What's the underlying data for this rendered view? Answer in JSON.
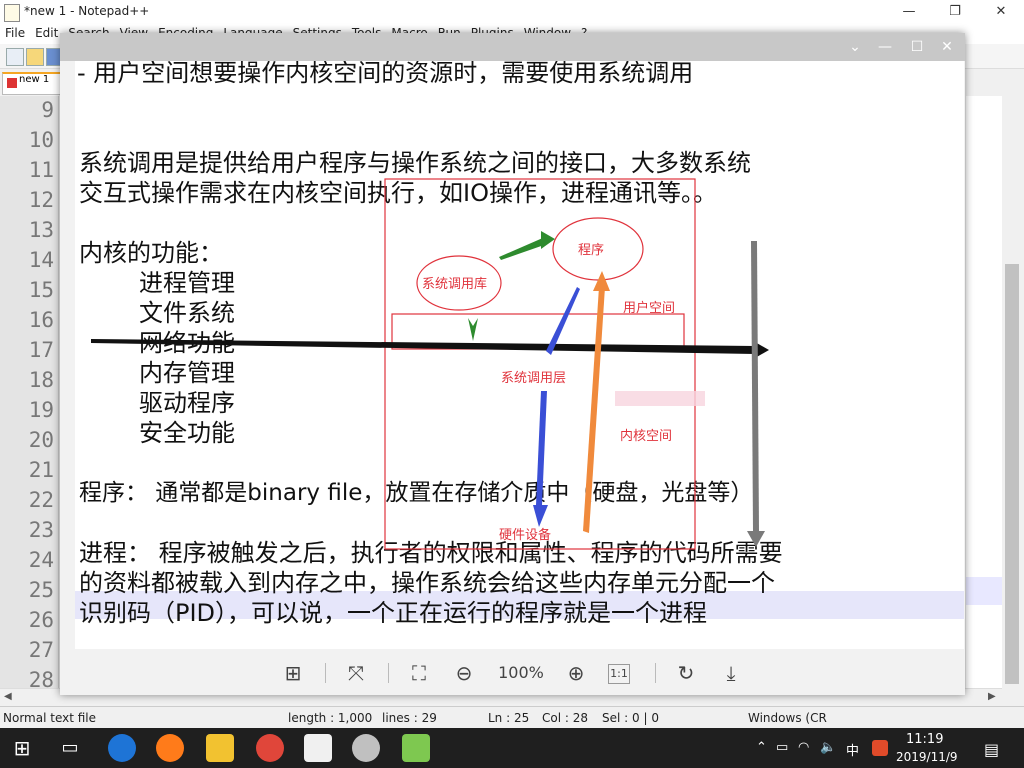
{
  "window": {
    "title": "*new 1 - Notepad++",
    "minimize": "—",
    "maximize": "❐",
    "close": "✕"
  },
  "menu": [
    "File",
    "Edit",
    "Search",
    "View",
    "Encoding",
    "Language",
    "Settings",
    "Tools",
    "Macro",
    "Run",
    "Plugins",
    "Window",
    "?"
  ],
  "tab": {
    "label": "new 1"
  },
  "line_numbers": [
    "9",
    "10",
    "11",
    "12",
    "13",
    "14",
    "15",
    "16",
    "17",
    "18",
    "19",
    "20",
    "21",
    "22",
    "23",
    "24",
    "25",
    "26",
    "27",
    "28"
  ],
  "status": {
    "filetype": "Normal text file",
    "length": "length : 1,000",
    "lines": "lines : 29",
    "ln": "Ln : 25",
    "col": "Col : 28",
    "sel": "Sel : 0 | 0",
    "eol": "Windows (CR"
  },
  "viewer": {
    "zoom": "100%",
    "controls": {
      "collapse": "⌄",
      "minimize": "—",
      "maximize": "☐",
      "close": "✕"
    }
  },
  "document": {
    "line_partial": "- 用户空间想要操作内核空间的资源时，需要使用系统调用",
    "para1": [
      "系统调用是提供给用户程序与操作系统之间的接口，大多数系统",
      "交互式操作需求在内核空间执行，如IO操作，进程通讯等。。"
    ],
    "kernel_heading": "内核的功能：",
    "kernel_items": [
      "进程管理",
      "文件系统",
      "网络功能",
      "内存管理",
      "驱动程序",
      "安全功能"
    ],
    "program_line": "程序：  通常都是binary file，放置在存储介质中（硬盘，光盘等）",
    "process_lines": [
      "进程：  程序被触发之后，执行者的权限和属性、程序的代码所需要",
      "的资料都被载入到内存之中，操作系统会给这些内存单元分配一个",
      "识别码（PID），可以说，一个正在运行的程序就是一个进程"
    ]
  },
  "annotations": {
    "program": "程序",
    "syscall_lib": "系统调用库",
    "user_space": "用户空间",
    "syscall_layer": "系统调用层",
    "kernel_space": "内核空间",
    "hardware": "硬件设备",
    "colors": {
      "red": "#e0333c",
      "green": "#2e8b2e",
      "blue": "#3a4fd6",
      "orange": "#f08a3c",
      "gray": "#7a7a7a",
      "black": "#111111"
    }
  },
  "taskbar": {
    "time": "11:19",
    "date": "2019/11/9",
    "ime": "中",
    "apps": [
      "start-button",
      "task-view",
      "edge",
      "firefox",
      "file-explorer",
      "browser-swirl",
      "image-viewer-app",
      "disc-app",
      "notepadpp"
    ]
  }
}
